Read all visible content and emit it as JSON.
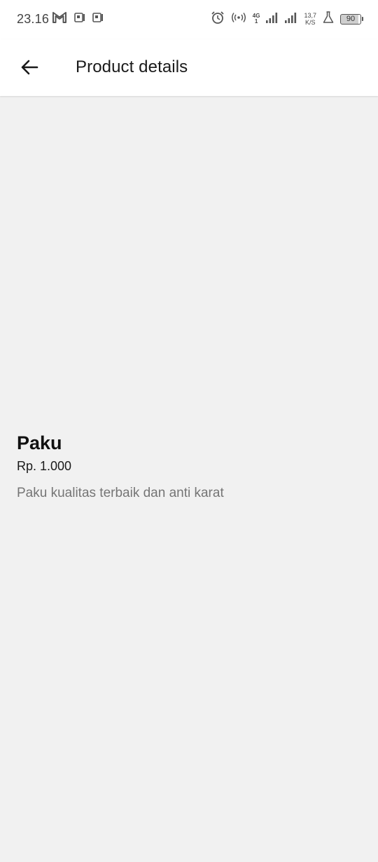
{
  "status_bar": {
    "time": "23.16",
    "left_icons": [
      "gmail-icon",
      "pdf-app-icon",
      "pdf-app-icon"
    ],
    "right_icons": [
      "alarm-icon",
      "hotspot-icon",
      "signal-4g-icon",
      "signal-icon",
      "lab-flask-icon"
    ],
    "network_type": "4G",
    "network_sub": "1",
    "net_speed_value": "13,7",
    "net_speed_unit": "K/S",
    "battery_level": "90"
  },
  "app_bar": {
    "title": "Product details",
    "back_icon": "arrow-left-icon"
  },
  "product": {
    "name": "Paku",
    "price": "Rp. 1.000",
    "description": "Paku kualitas terbaik dan anti karat"
  },
  "colors": {
    "background": "#f1f1f1",
    "app_bar": "#ffffff",
    "description_text": "#757575"
  }
}
